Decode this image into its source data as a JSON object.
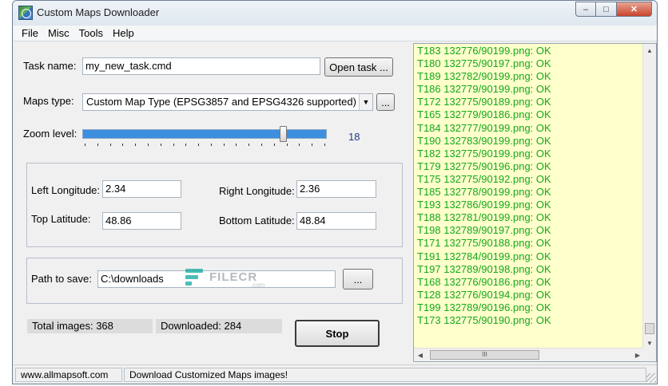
{
  "window": {
    "title": "Custom Maps Downloader",
    "caption": {
      "minimize": "–",
      "maximize": "□",
      "close": "✕"
    }
  },
  "menu": [
    "File",
    "Misc",
    "Tools",
    "Help"
  ],
  "form": {
    "task_name_label": "Task name:",
    "task_name_value": "my_new_task.cmd",
    "open_task_button": "Open task ...",
    "maps_type_label": "Maps type:",
    "maps_type_value": "Custom Map Type (EPSG3857 and EPSG4326 supported)",
    "maps_type_more_button": "...",
    "zoom_label": "Zoom level:",
    "zoom_value": "18",
    "zoom_fraction": 0.82,
    "left_longitude_label": "Left Longitude:",
    "left_longitude_value": "2.34",
    "right_longitude_label": "Right Longitude:",
    "right_longitude_value": "2.36",
    "top_latitude_label": "Top Latitude:",
    "top_latitude_value": "48.86",
    "bottom_latitude_label": "Bottom Latitude:",
    "bottom_latitude_value": "48.84",
    "path_label": "Path to save:",
    "path_value": "C:\\downloads",
    "path_browse_button": "...",
    "total_images": "Total images: 368",
    "downloaded": "Downloaded: 284",
    "stop_button": "Stop"
  },
  "log": {
    "lines": [
      "T183 132776/90199.png: OK",
      "T180 132775/90197.png: OK",
      "T189 132782/90199.png: OK",
      "T186 132779/90199.png: OK",
      "T172 132775/90189.png: OK",
      "T165 132779/90186.png: OK",
      "T184 132777/90199.png: OK",
      "T190 132783/90199.png: OK",
      "T182 132775/90199.png: OK",
      "T179 132775/90196.png: OK",
      "T175 132775/90192.png: OK",
      "T185 132778/90199.png: OK",
      "T193 132786/90199.png: OK",
      "T188 132781/90199.png: OK",
      "T198 132789/90197.png: OK",
      "T171 132775/90188.png: OK",
      "T191 132784/90199.png: OK",
      "T197 132789/90198.png: OK",
      "T168 132776/90186.png: OK",
      "T128 132776/90194.png: OK",
      "T199 132789/90196.png: OK",
      "T173 132775/90190.png: OK"
    ],
    "text_color": "#14a81c",
    "background": "#ffffcc",
    "hscroll_grip": "III"
  },
  "statusbar": {
    "website": "www.allmapsoft.com",
    "message": "Download Customized Maps images!"
  },
  "watermark": {
    "text": "FILECR",
    "sub": ".com"
  }
}
